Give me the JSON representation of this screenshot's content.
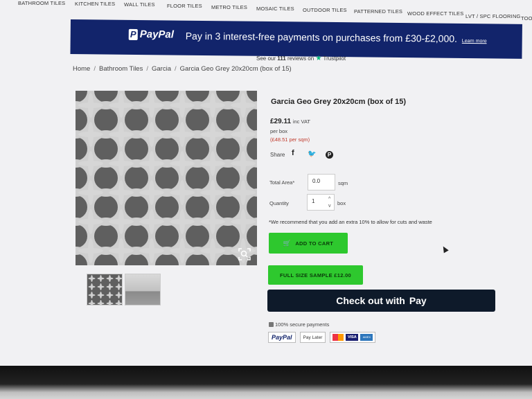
{
  "nav": {
    "items": [
      "BATHROOM TILES",
      "KITCHEN TILES",
      "WALL TILES",
      "FLOOR TILES",
      "METRO TILES",
      "MOSAIC TILES",
      "OUTDOOR TILES",
      "PATTERNED TILES",
      "WOOD EFFECT TILES",
      "LVT / SPC FLOORING",
      "TOO"
    ]
  },
  "banner": {
    "logo": "PayPal",
    "logo_mark": "P",
    "text": "Pay in 3 interest-free payments on purchases from £30-£2,000.",
    "learn_more": "Learn more",
    "bg_color": "#12246b"
  },
  "trustpilot": {
    "prefix": "See our",
    "count": "111",
    "suffix": "reviews on",
    "brand": "Trustpilot",
    "star_icon": "star-icon"
  },
  "breadcrumb": {
    "items": [
      "Home",
      "Bathroom Tiles",
      "Garcia",
      "Garcia Geo Grey 20x20cm (box of 15)"
    ],
    "separator": "/"
  },
  "product": {
    "title": "Garcia Geo Grey 20x20cm (box of 15)",
    "price": "£29.11",
    "vat": "inc VAT",
    "per_box": "per box",
    "per_sqm": "(£48.51 per sqm)",
    "share_label": "Share",
    "social": {
      "facebook": "f",
      "twitter": "🐦",
      "pinterest": "P"
    },
    "total_area_label": "Total Area*",
    "total_area_value": "0.0",
    "total_area_unit": "sqm",
    "quantity_label": "Quantity",
    "quantity_value": "1",
    "quantity_unit": "box",
    "stepper_up": "^",
    "stepper_down": "v",
    "recommend": "*We recommend that you add an extra 10% to allow for cuts and waste",
    "add_to_cart": "ADD TO CART",
    "cart_icon": "cart-icon",
    "sample": "FULL SIZE SAMPLE £12.00",
    "applepay_prefix": "Check out with",
    "applepay_brand": "Pay",
    "secure": "100% secure payments",
    "badge_paypal": "PayPal",
    "badge_paylater": "Pay Later",
    "badge_visa": "VISA",
    "badge_amex": "AMEX",
    "accent_green": "#2ec82e",
    "applepay_bg": "#0e1a2a"
  }
}
